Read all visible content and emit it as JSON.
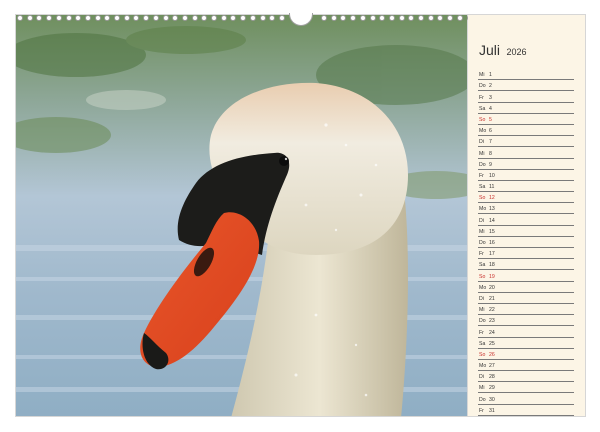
{
  "calendar": {
    "month": "Juli",
    "year": "2026",
    "accent_color": "#c8302c",
    "days": [
      {
        "weekday": "Mi",
        "day": "1",
        "sunday": false
      },
      {
        "weekday": "Do",
        "day": "2",
        "sunday": false
      },
      {
        "weekday": "Fr",
        "day": "3",
        "sunday": false
      },
      {
        "weekday": "Sa",
        "day": "4",
        "sunday": false
      },
      {
        "weekday": "So",
        "day": "5",
        "sunday": true
      },
      {
        "weekday": "Mo",
        "day": "6",
        "sunday": false
      },
      {
        "weekday": "Di",
        "day": "7",
        "sunday": false
      },
      {
        "weekday": "Mi",
        "day": "8",
        "sunday": false
      },
      {
        "weekday": "Do",
        "day": "9",
        "sunday": false
      },
      {
        "weekday": "Fr",
        "day": "10",
        "sunday": false
      },
      {
        "weekday": "Sa",
        "day": "11",
        "sunday": false
      },
      {
        "weekday": "So",
        "day": "12",
        "sunday": true
      },
      {
        "weekday": "Mo",
        "day": "13",
        "sunday": false
      },
      {
        "weekday": "Di",
        "day": "14",
        "sunday": false
      },
      {
        "weekday": "Mi",
        "day": "15",
        "sunday": false
      },
      {
        "weekday": "Do",
        "day": "16",
        "sunday": false
      },
      {
        "weekday": "Fr",
        "day": "17",
        "sunday": false
      },
      {
        "weekday": "Sa",
        "day": "18",
        "sunday": false
      },
      {
        "weekday": "So",
        "day": "19",
        "sunday": true
      },
      {
        "weekday": "Mo",
        "day": "20",
        "sunday": false
      },
      {
        "weekday": "Di",
        "day": "21",
        "sunday": false
      },
      {
        "weekday": "Mi",
        "day": "22",
        "sunday": false
      },
      {
        "weekday": "Do",
        "day": "23",
        "sunday": false
      },
      {
        "weekday": "Fr",
        "day": "24",
        "sunday": false
      },
      {
        "weekday": "Sa",
        "day": "25",
        "sunday": false
      },
      {
        "weekday": "So",
        "day": "26",
        "sunday": true
      },
      {
        "weekday": "Mo",
        "day": "27",
        "sunday": false
      },
      {
        "weekday": "Di",
        "day": "28",
        "sunday": false
      },
      {
        "weekday": "Mi",
        "day": "29",
        "sunday": false
      },
      {
        "weekday": "Do",
        "day": "30",
        "sunday": false
      },
      {
        "weekday": "Fr",
        "day": "31",
        "sunday": false
      }
    ]
  }
}
